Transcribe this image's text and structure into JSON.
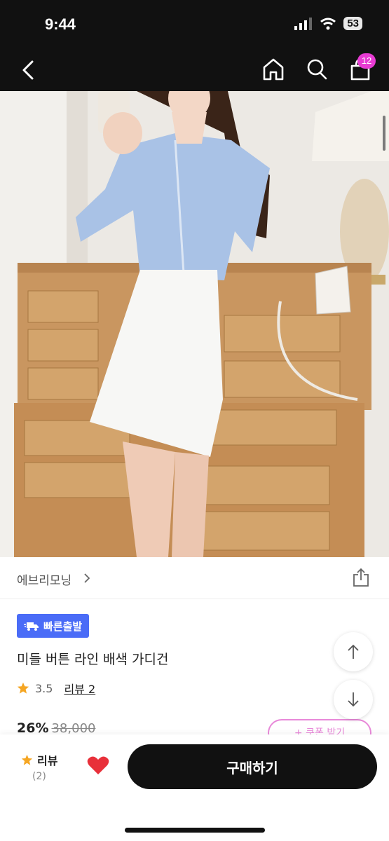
{
  "status_bar": {
    "time": "9:44",
    "battery": "53"
  },
  "nav": {
    "cart_count": "12"
  },
  "product": {
    "brand": "에브리모닝",
    "badge": "빠른출발",
    "title": "미들 버튼 라인 배색 가디건",
    "rating": "3.5",
    "review_link": "리뷰 2",
    "discount": "26%",
    "original_price": "38,000",
    "coupon_label": "+ 쿠폰 받기"
  },
  "bottom_bar": {
    "review_label": "리뷰",
    "review_count": "(2)",
    "buy_label": "구매하기"
  },
  "colors": {
    "accent_pink": "#e83bd3",
    "badge_blue": "#4a6cf7",
    "star": "#f5a623",
    "heart": "#e8303a"
  }
}
